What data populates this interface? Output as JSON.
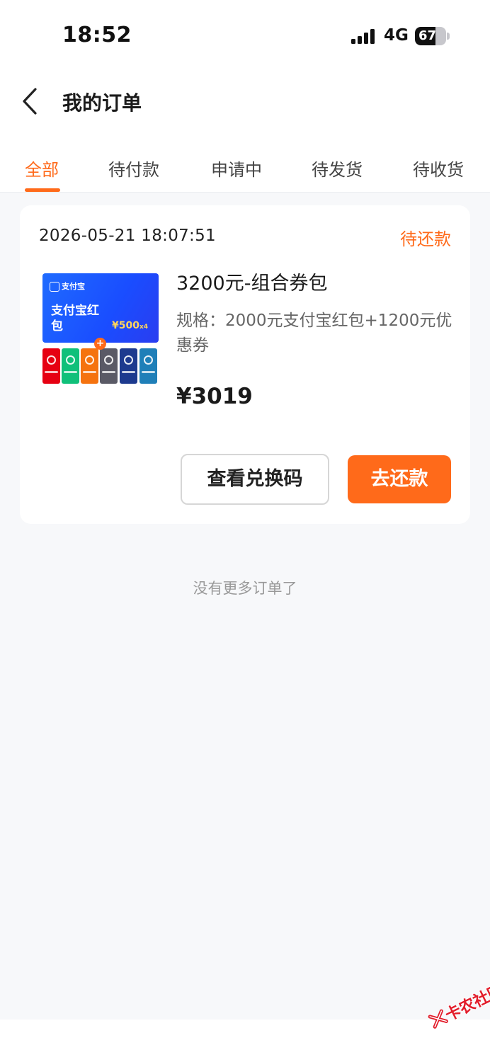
{
  "status_bar": {
    "time": "18:52",
    "network": "4G",
    "battery_level": "67",
    "battery_fraction": 0.67
  },
  "header": {
    "back_icon": "chevron-left-icon",
    "title": "我的订单"
  },
  "tabs": [
    {
      "label": "全部",
      "active": true
    },
    {
      "label": "待付款",
      "active": false
    },
    {
      "label": "申请中",
      "active": false
    },
    {
      "label": "待发货",
      "active": false
    },
    {
      "label": "待收货",
      "active": false
    }
  ],
  "order": {
    "time": "2026-05-21 18:07:51",
    "status": "待还款",
    "product": {
      "thumbnail": {
        "logo_text": "支付宝",
        "title": "支付宝红包",
        "amount": "¥500",
        "multiplier": "x4",
        "plus": "+"
      },
      "name": "3200元-组合券包",
      "spec": "规格：2000元支付宝红包+1200元优惠券",
      "price": "¥3019"
    },
    "buttons": {
      "view_code": "查看兑换码",
      "repay": "去还款"
    }
  },
  "footer": {
    "no_more": "没有更多订单了"
  },
  "watermark": {
    "text": "卡农社区"
  },
  "colors": {
    "accent": "#ff6a1a",
    "background": "#f7f8fa",
    "card": "#ffffff",
    "alipay_blue": "#1a4dff"
  }
}
